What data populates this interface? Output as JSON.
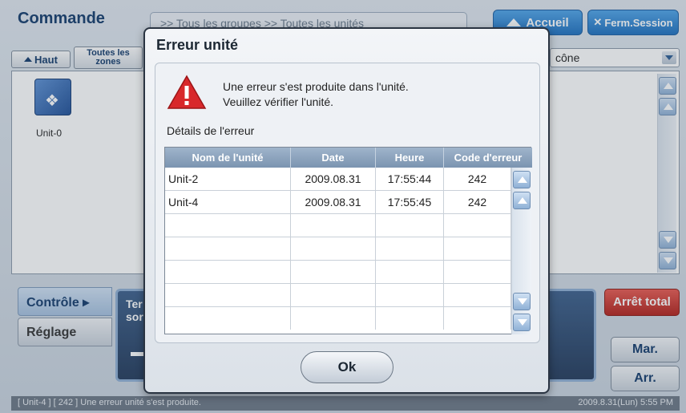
{
  "app": {
    "title": "Commande",
    "breadcrumb": ">> Tous les groupes >> Toutes les unités",
    "accueil_label": "Accueil",
    "fermer_label": "Ferm.Session",
    "haut_label": "Haut",
    "zones_label": "Toutes les zones",
    "view_select": "cône",
    "unit_label": "Unit-0",
    "control_tab": "Contrôle ▸",
    "reglage_tab": "Réglage",
    "temp_text": "Ter sor",
    "arret_total": "Arrêt total",
    "mar": "Mar.",
    "arr": "Arr.",
    "status_message": "[ Unit-4 ] [ 242 ] Une erreur unité s'est produite.",
    "status_time": "2009.8.31(Lun) 5:55 PM"
  },
  "dialog": {
    "title": "Erreur unité",
    "message_line1": "Une erreur s'est produite dans l'unité.",
    "message_line2": "Veuillez vérifier l'unité.",
    "details_label": "Détails de l'erreur",
    "columns": [
      "Nom de l'unité",
      "Date",
      "Heure",
      "Code d'erreur"
    ],
    "rows": [
      {
        "unit": "Unit-2",
        "date": "2009.08.31",
        "time": "17:55:44",
        "code": "242"
      },
      {
        "unit": "Unit-4",
        "date": "2009.08.31",
        "time": "17:55:45",
        "code": "242"
      }
    ],
    "ok_label": "Ok"
  },
  "colors": {
    "accent": "#1d6fbf",
    "danger": "#d8282b",
    "header_row": "#8aa1bb"
  }
}
